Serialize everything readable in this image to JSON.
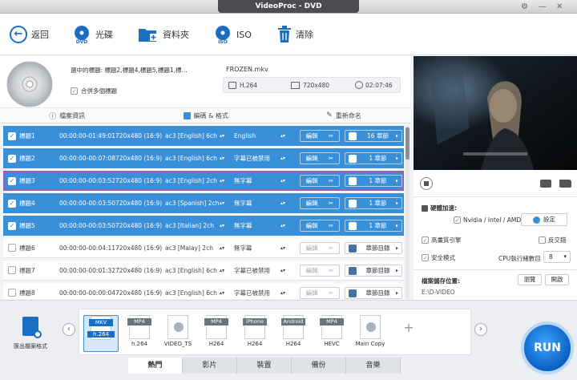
{
  "window": {
    "title": "VideoProc - DVD"
  },
  "toolbar": {
    "back": "返回",
    "dvd": "光碟",
    "folder": "資料夾",
    "iso": "ISO",
    "clear": "清除"
  },
  "info": {
    "selected_titles": "選中的標題: 標題2,標題4,標題5,標題1,標...",
    "merge_label": "合併多個標題",
    "file_name": "FROZEN.mkv",
    "codec": "H.264",
    "resolution": "720x480",
    "duration": "02:07:46"
  },
  "subtabs": {
    "file_info": "檔案資訊",
    "encode": "編碼 & 格式",
    "rename": "重新命名"
  },
  "titles": [
    {
      "name": "標題1",
      "time": "00:00:00-01:49:01",
      "res": "720x480 (16:9)",
      "audio": "ac3 [English] 6ch",
      "sub": "English",
      "edit": "編輯",
      "chapters": "16 章節",
      "selected": true
    },
    {
      "name": "標題2",
      "time": "00:00:00-00:07:08",
      "res": "720x480 (16:9)",
      "audio": "ac3 [English] 6ch",
      "sub": "字幕已被禁用",
      "edit": "編輯",
      "chapters": "1 章節",
      "selected": true
    },
    {
      "name": "標題3",
      "time": "00:00:00-00:03:52",
      "res": "720x480 (16:9)",
      "audio": "ac3 [English] 2ch",
      "sub": "無字幕",
      "edit": "編輯",
      "chapters": "1 章節",
      "selected": true
    },
    {
      "name": "標題4",
      "time": "00:00:00-00:03:50",
      "res": "720x480 (16:9)",
      "audio": "ac3 [Spanish] 2ch",
      "sub": "無字幕",
      "edit": "編輯",
      "chapters": "1 章節",
      "selected": true
    },
    {
      "name": "標題5",
      "time": "00:00:00-00:03:50",
      "res": "720x480 (16:9)",
      "audio": "ac3 [Italian] 2ch",
      "sub": "無字幕",
      "edit": "編輯",
      "chapters": "1 章節",
      "selected": true
    },
    {
      "name": "標題6",
      "time": "00:00:00-00:04:11",
      "res": "720x480 (16:9)",
      "audio": "ac3 [Malay] 2ch",
      "sub": "無字幕",
      "edit": "編輯",
      "chapters": "章節目錄",
      "selected": false
    },
    {
      "name": "標題7",
      "time": "00:00:00-00:01:32",
      "res": "720x480 (16:9)",
      "audio": "ac3 [English] 6ch",
      "sub": "字幕已被禁用",
      "edit": "編輯",
      "chapters": "章節目錄",
      "selected": false
    },
    {
      "name": "標題8",
      "time": "00:00:00-00:00:04",
      "res": "720x480 (16:9)",
      "audio": "ac3 [English] 6ch",
      "sub": "字幕已被禁用",
      "edit": "編輯",
      "chapters": "章節目錄",
      "selected": false
    }
  ],
  "right": {
    "hw_accel": "硬體加速:",
    "gpu": "Nvidia / Intel / AMD",
    "settings": "設定",
    "hq_engine": "高畫質引擎",
    "deinterlace": "反交錯",
    "safe_mode": "安全模式",
    "cpu_cores_label": "CPU執行緒數目",
    "cpu_cores": "8",
    "output_label": "檔案儲存位置:",
    "browse": "瀏覽",
    "open": "開啟",
    "output_path": "E:\\D-VIDEO"
  },
  "bottom": {
    "output_format": "匯出檔案格式",
    "formats": [
      {
        "tag": "MKV",
        "label": "h.264",
        "active": true
      },
      {
        "tag": "MP4",
        "label": "h.264",
        "active": false
      },
      {
        "tag": "",
        "label": "VIDEO_TS",
        "active": false
      },
      {
        "tag": "MP4",
        "label": "H264",
        "active": false
      },
      {
        "tag": "iPhone",
        "label": "H264",
        "active": false
      },
      {
        "tag": "Android",
        "label": "H264",
        "active": false
      },
      {
        "tag": "MP4",
        "label": "HEVC",
        "active": false
      },
      {
        "tag": "",
        "label": "Main Copy",
        "active": false
      }
    ],
    "tabs": [
      "熱門",
      "影片",
      "裝置",
      "備份",
      "音樂"
    ],
    "run": "RUN"
  },
  "colors": {
    "accent": "#3a8fd9",
    "selected_row": "#3a8fd9",
    "highlight_outline": "#9b5fb0"
  }
}
